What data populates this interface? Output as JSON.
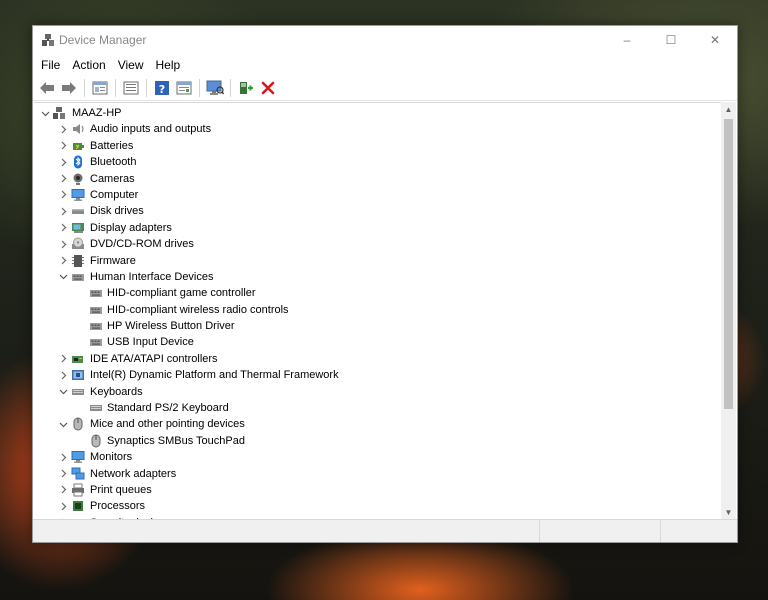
{
  "window": {
    "title": "Device Manager",
    "controls": {
      "minimize": "–",
      "maximize": "☐",
      "close": "✕"
    }
  },
  "menu": [
    "File",
    "Action",
    "View",
    "Help"
  ],
  "toolbar": [
    "back-arrow-icon",
    "forward-arrow-icon",
    "sep",
    "properties-view-icon",
    "sep",
    "list-view-icon",
    "sep",
    "help-icon",
    "details-view-icon",
    "sep",
    "scan-monitor-icon",
    "sep",
    "add-driver-icon",
    "uninstall-x-icon"
  ],
  "tree": [
    {
      "label": "MAAZ-HP",
      "level": 0,
      "state": "expanded",
      "icon": "computer-root-icon"
    },
    {
      "label": "Audio inputs and outputs",
      "level": 1,
      "state": "collapsed",
      "icon": "speaker-icon"
    },
    {
      "label": "Batteries",
      "level": 1,
      "state": "collapsed",
      "icon": "battery-icon"
    },
    {
      "label": "Bluetooth",
      "level": 1,
      "state": "collapsed",
      "icon": "bluetooth-icon"
    },
    {
      "label": "Cameras",
      "level": 1,
      "state": "collapsed",
      "icon": "camera-icon"
    },
    {
      "label": "Computer",
      "level": 1,
      "state": "collapsed",
      "icon": "monitor-icon"
    },
    {
      "label": "Disk drives",
      "level": 1,
      "state": "collapsed",
      "icon": "disk-drive-icon"
    },
    {
      "label": "Display adapters",
      "level": 1,
      "state": "collapsed",
      "icon": "display-adapter-icon"
    },
    {
      "label": "DVD/CD-ROM drives",
      "level": 1,
      "state": "collapsed",
      "icon": "dvd-drive-icon"
    },
    {
      "label": "Firmware",
      "level": 1,
      "state": "collapsed",
      "icon": "firmware-icon"
    },
    {
      "label": "Human Interface Devices",
      "level": 1,
      "state": "expanded",
      "icon": "hid-icon"
    },
    {
      "label": "HID-compliant game controller",
      "level": 2,
      "state": "leaf",
      "icon": "hid-icon"
    },
    {
      "label": "HID-compliant wireless radio controls",
      "level": 2,
      "state": "leaf",
      "icon": "hid-icon"
    },
    {
      "label": "HP Wireless Button Driver",
      "level": 2,
      "state": "leaf",
      "icon": "hid-icon"
    },
    {
      "label": "USB Input Device",
      "level": 2,
      "state": "leaf",
      "icon": "hid-icon"
    },
    {
      "label": "IDE ATA/ATAPI controllers",
      "level": 1,
      "state": "collapsed",
      "icon": "ide-controller-icon"
    },
    {
      "label": "Intel(R) Dynamic Platform and Thermal Framework",
      "level": 1,
      "state": "collapsed",
      "icon": "thermal-framework-icon"
    },
    {
      "label": "Keyboards",
      "level": 1,
      "state": "expanded",
      "icon": "keyboard-icon"
    },
    {
      "label": "Standard PS/2 Keyboard",
      "level": 2,
      "state": "leaf",
      "icon": "keyboard-icon"
    },
    {
      "label": "Mice and other pointing devices",
      "level": 1,
      "state": "expanded",
      "icon": "mouse-icon"
    },
    {
      "label": "Synaptics SMBus TouchPad",
      "level": 2,
      "state": "leaf",
      "icon": "mouse-icon"
    },
    {
      "label": "Monitors",
      "level": 1,
      "state": "collapsed",
      "icon": "monitor-icon"
    },
    {
      "label": "Network adapters",
      "level": 1,
      "state": "collapsed",
      "icon": "network-adapter-icon"
    },
    {
      "label": "Print queues",
      "level": 1,
      "state": "collapsed",
      "icon": "printer-icon"
    },
    {
      "label": "Processors",
      "level": 1,
      "state": "collapsed",
      "icon": "processor-icon"
    },
    {
      "label": "Security devices",
      "level": 1,
      "state": "collapsed",
      "icon": "security-device-icon"
    }
  ],
  "colors": {
    "accent_blue": "#1f6fd1",
    "uninstall_red": "#d41a1a",
    "add_green": "#2a9d2a"
  }
}
